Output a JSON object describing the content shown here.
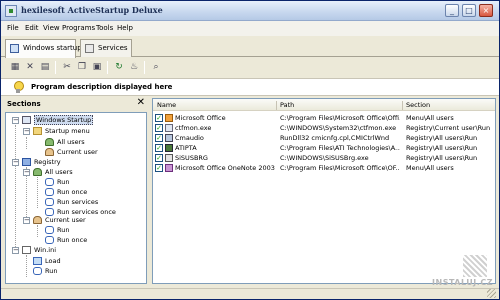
{
  "window": {
    "title": "hexilesoft ActiveStartup Deluxe",
    "minimize": "_",
    "maximize": "□",
    "close": "×"
  },
  "menu": [
    "File",
    "Edit",
    "View",
    "Programs",
    "Tools",
    "Help"
  ],
  "tabs": [
    {
      "label": "Windows startup",
      "active": true
    },
    {
      "label": "Services",
      "active": false
    }
  ],
  "toolbar": {
    "icons": [
      "new-icon",
      "delete-icon",
      "properties-icon",
      "cut-icon",
      "copy-icon",
      "paste-icon",
      "refresh-icon",
      "tool-icon",
      "search-icon"
    ],
    "glyphs": [
      "▦",
      "✕",
      "▤",
      "✂",
      "❐",
      "▣",
      "↻",
      "♨",
      "⌕"
    ]
  },
  "description": {
    "text": "Program description displayed here"
  },
  "sections": {
    "title": "Sections",
    "close": "✕",
    "tree": [
      {
        "label": "Windows Startup",
        "icon": "computer-icon"
      },
      {
        "label": "Startup menu",
        "icon": "folder-icon"
      },
      {
        "label": "All users",
        "icon": "users-icon"
      },
      {
        "label": "Current user",
        "icon": "user-icon"
      },
      {
        "label": "Registry",
        "icon": "registry-icon"
      },
      {
        "label": "All users",
        "icon": "users-icon"
      },
      {
        "label": "Run",
        "icon": "run-icon"
      },
      {
        "label": "Run once",
        "icon": "run-icon"
      },
      {
        "label": "Run services",
        "icon": "run-icon"
      },
      {
        "label": "Run services once",
        "icon": "run-icon"
      },
      {
        "label": "Current user",
        "icon": "user-icon"
      },
      {
        "label": "Run",
        "icon": "run-icon"
      },
      {
        "label": "Run once",
        "icon": "run-icon"
      },
      {
        "label": "Win.ini",
        "icon": "ini-icon"
      },
      {
        "label": "Load",
        "icon": "load-icon"
      },
      {
        "label": "Run",
        "icon": "run-icon"
      }
    ]
  },
  "list": {
    "columns": [
      "Name",
      "Path",
      "Section"
    ],
    "rows": [
      {
        "checked": true,
        "icon": "office-icon",
        "name": "Microsoft Office",
        "path": "C:\\Program Files\\Microsoft Office\\Offi...",
        "section": "Menu\\All users"
      },
      {
        "checked": true,
        "icon": "exe-icon",
        "name": "ctfmon.exe",
        "path": "C:\\WINDOWS\\System32\\ctfmon.exe",
        "section": "Registry\\Current user\\Run"
      },
      {
        "checked": true,
        "icon": "audio-icon",
        "name": "Cmaudio",
        "path": "RunDll32 cmicnfg.cpl,CMICtrlWnd",
        "section": "Registry\\All users\\Run"
      },
      {
        "checked": true,
        "icon": "ati-icon",
        "name": "ATIPTA",
        "path": "C:\\Program Files\\ATI Technologies\\A...",
        "section": "Registry\\All users\\Run"
      },
      {
        "checked": true,
        "icon": "sis-icon",
        "name": "SiSUSBRG",
        "path": "C:\\WINDOWS\\SiSUSBrg.exe",
        "section": "Registry\\All users\\Run"
      },
      {
        "checked": true,
        "icon": "onenote-icon",
        "name": "Microsoft Office OneNote 2003...",
        "path": "C:\\Program Files\\Microsoft Office\\OF...",
        "section": "Menu\\All users"
      }
    ]
  },
  "watermark": {
    "text": "INSTALUJ.CZ"
  }
}
